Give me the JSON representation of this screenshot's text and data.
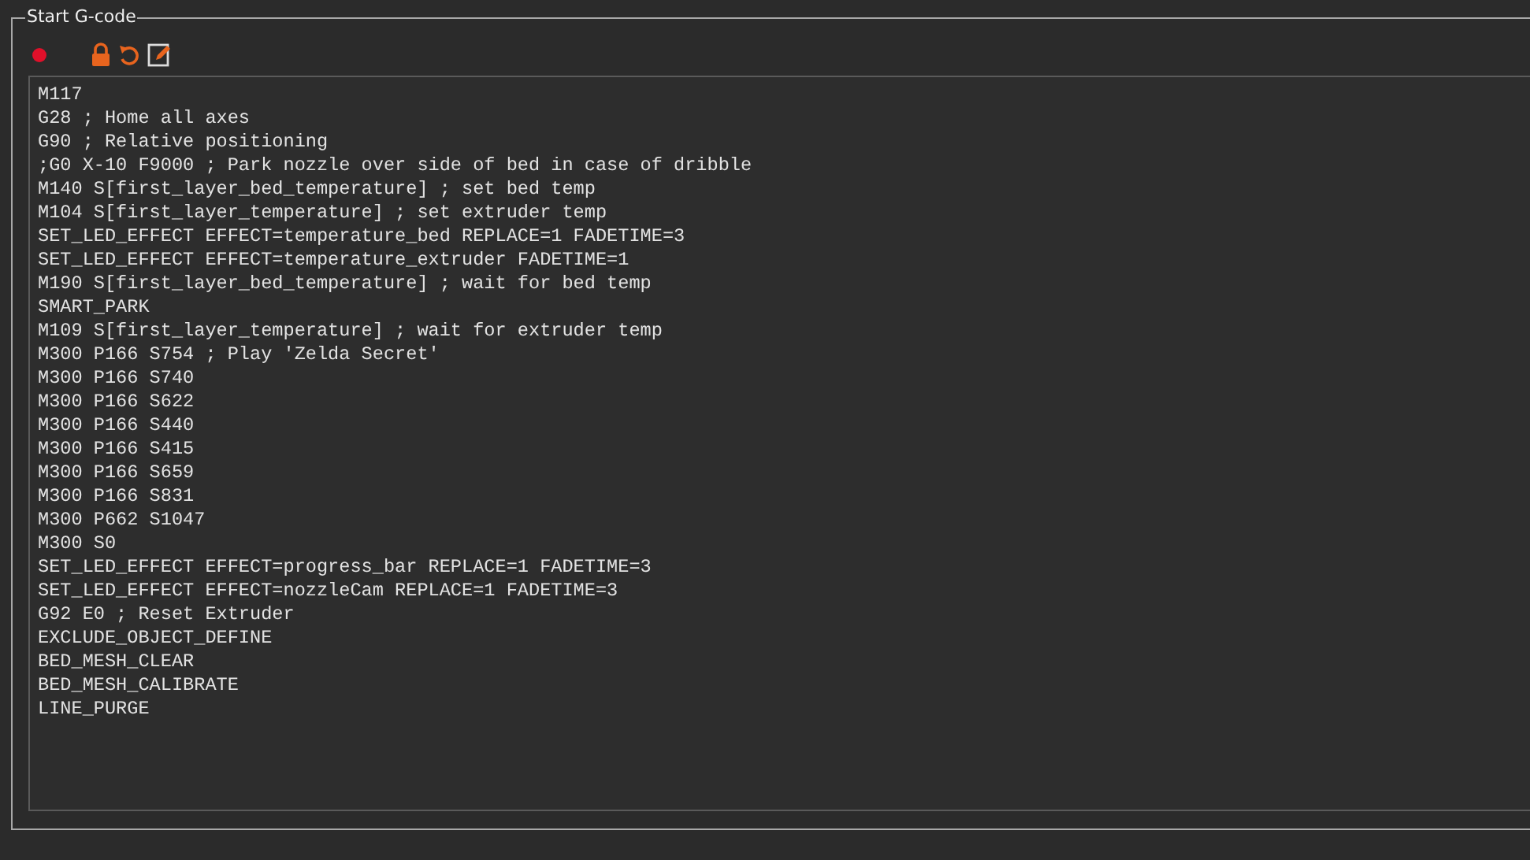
{
  "group": {
    "title": "Start G-code"
  },
  "editor": {
    "lines": [
      "M117",
      "G28 ; Home all axes",
      "G90 ; Relative positioning",
      ";G0 X-10 F9000 ; Park nozzle over side of bed in case of dribble",
      "M140 S[first_layer_bed_temperature] ; set bed temp",
      "M104 S[first_layer_temperature] ; set extruder temp",
      "SET_LED_EFFECT EFFECT=temperature_bed REPLACE=1 FADETIME=3",
      "SET_LED_EFFECT EFFECT=temperature_extruder FADETIME=1",
      "M190 S[first_layer_bed_temperature] ; wait for bed temp",
      "SMART_PARK",
      "M109 S[first_layer_temperature] ; wait for extruder temp",
      "M300 P166 S754 ; Play 'Zelda Secret'",
      "M300 P166 S740",
      "M300 P166 S622",
      "M300 P166 S440",
      "M300 P166 S415",
      "M300 P166 S659",
      "M300 P166 S831",
      "M300 P662 S1047",
      "M300 S0",
      "SET_LED_EFFECT EFFECT=progress_bar REPLACE=1 FADETIME=3",
      "SET_LED_EFFECT EFFECT=nozzleCam REPLACE=1 FADETIME=3",
      "G92 E0 ; Reset Extruder",
      "EXCLUDE_OBJECT_DEFINE",
      "BED_MESH_CLEAR",
      "BED_MESH_CALIBRATE",
      "LINE_PURGE"
    ]
  }
}
